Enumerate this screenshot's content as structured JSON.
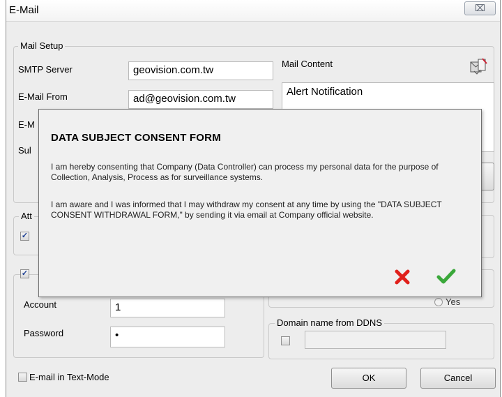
{
  "window": {
    "title": "E-Mail",
    "close_symbol": "⌧"
  },
  "mail_setup": {
    "legend": "Mail Setup",
    "smtp_label": "SMTP Server",
    "smtp_value": "geovision.com.tw",
    "from_label": "E-Mail From",
    "from_value": "ad@geovision.com.tw",
    "to_label_partial": "E-M",
    "subject_label_partial": "Sul",
    "mail_content_label": "Mail Content",
    "mail_content_value": "Alert Notification"
  },
  "attach": {
    "label_partial": "Att"
  },
  "auth": {
    "account_label": "Account",
    "account_value": "1",
    "password_label": "Password",
    "password_value": "•"
  },
  "ddns": {
    "legend": "Domain name from DDNS",
    "radio_label_partial": "Yes"
  },
  "footer": {
    "text_mode_label": "E-mail in Text-Mode",
    "ok_label": "OK",
    "cancel_label": "Cancel"
  },
  "consent_dialog": {
    "title": "DATA SUBJECT CONSENT FORM",
    "paragraph1": "I am hereby consenting that Company (Data Controller) can process my personal data for the purpose of Collection, Analysis, Process as for surveillance systems.",
    "paragraph2": "I am aware and I was informed that I may withdraw my consent at any time by using the \"DATA SUBJECT CONSENT WITHDRAWAL FORM,\" by sending it via email at Company official website.",
    "decline_icon": "red-x-icon",
    "accept_icon": "green-check-icon",
    "decline_color": "#e0201b",
    "accept_color": "#3aa83a"
  }
}
